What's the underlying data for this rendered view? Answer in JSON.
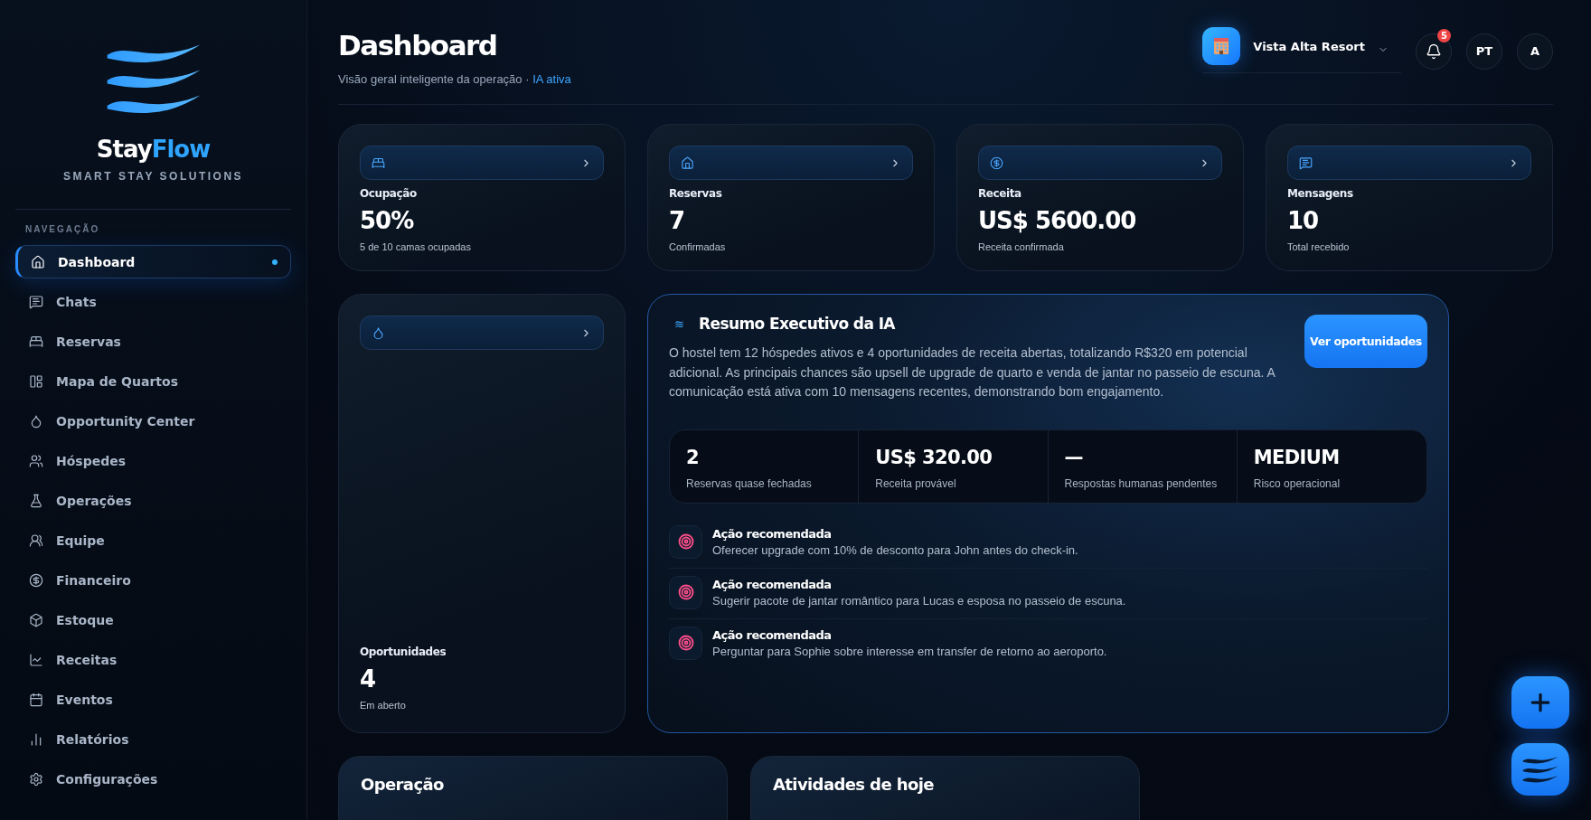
{
  "sidebar": {
    "brand_first": "Stay",
    "brand_second": "Flow",
    "tagline": "SMART STAY SOLUTIONS",
    "section": "NAVEGAÇÃO",
    "items": [
      {
        "label": "Dashboard",
        "selected": true
      },
      {
        "label": "Chats",
        "selected": false
      },
      {
        "label": "Reservas",
        "selected": false
      },
      {
        "label": "Mapa de Quartos",
        "selected": false
      },
      {
        "label": "Opportunity Center",
        "selected": false
      },
      {
        "label": "Hóspedes",
        "selected": false
      },
      {
        "label": "Operações",
        "selected": false
      },
      {
        "label": "Equipe",
        "selected": false
      },
      {
        "label": "Financeiro",
        "selected": false
      },
      {
        "label": "Estoque",
        "selected": false
      },
      {
        "label": "Receitas",
        "selected": false
      },
      {
        "label": "Eventos",
        "selected": false
      },
      {
        "label": "Relatórios",
        "selected": false
      },
      {
        "label": "Configurações",
        "selected": false
      }
    ]
  },
  "header": {
    "title": "Dashboard",
    "subtitle": "Visão geral inteligente da operação ·",
    "status": "IA ativa",
    "property": "Vista Alta Resort",
    "notifications": "5",
    "language": "PT",
    "avatar": "A"
  },
  "stats": [
    {
      "label": "Ocupação",
      "value": "50%",
      "note": "5 de 10 camas ocupadas"
    },
    {
      "label": "Reservas",
      "value": "7",
      "note": "Confirmadas"
    },
    {
      "label": "Receita",
      "value": "US$ 5600.00",
      "note": "Receita confirmada"
    },
    {
      "label": "Mensagens",
      "value": "10",
      "note": "Total recebido"
    }
  ],
  "opportunity": {
    "label": "Oportunidades",
    "value": "4",
    "note": "Em aberto"
  },
  "ai_summary": {
    "icon": "≋",
    "title": "Resumo Executivo da IA",
    "text": "O hostel tem 12 hóspedes ativos e 4 oportunidades de receita abertas, totalizando R$320 em potencial adicional. As principais chances são upsell de upgrade de quarto e venda de jantar no passeio de escuna. A comunicação está ativa com 10 mensagens recentes, demonstrando bom engajamento.",
    "button": "Ver oportunidades",
    "metrics": [
      {
        "value": "2",
        "label": "Reservas quase fechadas"
      },
      {
        "value": "US$ 320.00",
        "label": "Receita provável"
      },
      {
        "value": "—",
        "label": "Respostas humanas pendentes"
      },
      {
        "value": "MEDIUM",
        "label": "Risco operacional"
      }
    ],
    "actions": [
      {
        "title": "Ação recomendada",
        "text": "Oferecer upgrade com 10% de desconto para John antes do check-in."
      },
      {
        "title": "Ação recomendada",
        "text": "Sugerir pacote de jantar romântico para Lucas e esposa no passeio de escuna."
      },
      {
        "title": "Ação recomendada",
        "text": "Perguntar para Sophie sobre interesse em transfer de retorno ao aeroporto."
      }
    ]
  },
  "bottom_cards": [
    {
      "title": "Operação"
    },
    {
      "title": "Atividades de hoje"
    }
  ]
}
